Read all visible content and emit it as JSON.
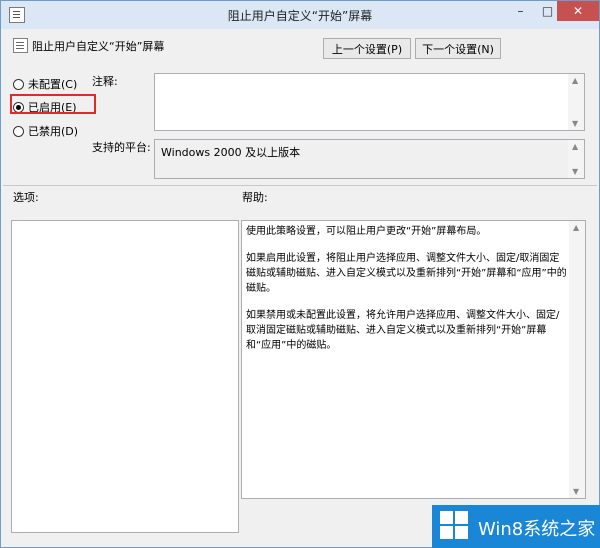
{
  "window": {
    "title": "阻止用户自定义“开始”屏幕",
    "controls": {
      "minimize": "–",
      "maximize": "□",
      "close": "✕"
    }
  },
  "policy": {
    "name": "阻止用户自定义“开始”屏幕"
  },
  "nav": {
    "prev_label": "上一个设置(P)",
    "next_label": "下一个设置(N)"
  },
  "state_options": [
    {
      "label": "未配置(C)",
      "selected": false
    },
    {
      "label": "已启用(E)",
      "selected": true
    },
    {
      "label": "已禁用(D)",
      "selected": false
    }
  ],
  "comment": {
    "label": "注释:",
    "value": ""
  },
  "platform": {
    "label": "支持的平台:",
    "value": "Windows 2000 及以上版本"
  },
  "options": {
    "label": "选项:"
  },
  "help": {
    "label": "帮助:",
    "paragraphs": [
      "使用此策略设置，可以阻止用户更改“开始”屏幕布局。",
      "如果启用此设置，将阻止用户选择应用、调整文件大小、固定/取消固定磁贴或辅助磁贴、进入自定义模式以及重新排列“开始”屏幕和“应用”中的磁贴。",
      "如果禁用或未配置此设置，将允许用户选择应用、调整文件大小、固定/取消固定磁贴或辅助磁贴、进入自定义模式以及重新排列“开始”屏幕和“应用”中的磁贴。"
    ]
  },
  "watermark": {
    "text": "Win8系统之家"
  },
  "colors": {
    "titlebar": "#dbe7f4",
    "close": "#c75050",
    "highlight": "#e0282e",
    "brand": "#1a86d6"
  }
}
